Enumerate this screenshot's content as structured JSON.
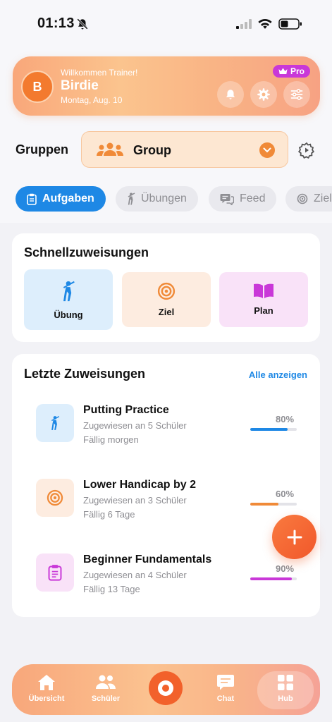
{
  "status_bar": {
    "time": "01:13"
  },
  "header": {
    "avatar_initial": "B",
    "welcome": "Willkommen Trainer!",
    "name": "Birdie",
    "date": "Montag, Aug. 10",
    "badge": "Pro",
    "icons": [
      "bell-icon",
      "gear-icon",
      "sliders-icon"
    ]
  },
  "groups": {
    "label": "Gruppen",
    "selected": "Group"
  },
  "tabs": [
    {
      "label": "Aufgaben",
      "icon": "clipboard-icon",
      "active": true
    },
    {
      "label": "Übungen",
      "icon": "golfer-icon",
      "active": false
    },
    {
      "label": "Feed",
      "icon": "chat-icon",
      "active": false
    },
    {
      "label": "Ziel",
      "icon": "target-icon",
      "active": false
    }
  ],
  "quick": {
    "title": "Schnellzuweisungen",
    "items": [
      {
        "label": "Übung",
        "icon": "golfer-icon"
      },
      {
        "label": "Ziel",
        "icon": "target-icon"
      },
      {
        "label": "Plan",
        "icon": "book-icon"
      }
    ]
  },
  "recent": {
    "title": "Letzte Zuweisungen",
    "see_all": "Alle anzeigen",
    "items": [
      {
        "title": "Putting Practice",
        "assigned": "Zugewiesen an 5 Schüler",
        "due": "Fällig morgen",
        "percent_label": "80%",
        "progress": 0.8,
        "color": "#1e88e5",
        "icon": "golfer-icon"
      },
      {
        "title": "Lower Handicap by 2",
        "assigned": "Zugewiesen an 3 Schüler",
        "due": "Fällig 6 Tage",
        "percent_label": "60%",
        "progress": 0.6,
        "color": "#f08a38",
        "icon": "target-icon"
      },
      {
        "title": "Beginner Fundamentals",
        "assigned": "Zugewiesen an 4 Schüler",
        "due": "Fällig 13 Tage",
        "percent_label": "90%",
        "progress": 0.9,
        "color": "#c938d8",
        "icon": "clipboard-icon"
      }
    ]
  },
  "nav": {
    "items": [
      {
        "label": "Übersicht",
        "icon": "home-icon"
      },
      {
        "label": "Schüler",
        "icon": "students-icon"
      },
      {
        "label": "Chat",
        "icon": "chat-icon"
      },
      {
        "label": "Hub",
        "icon": "grid-icon"
      }
    ]
  }
}
